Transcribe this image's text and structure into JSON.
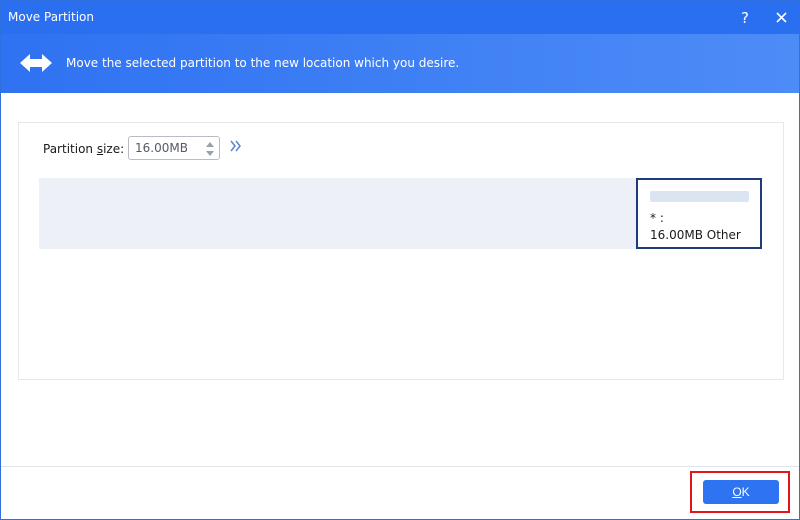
{
  "window": {
    "title": "Move Partition",
    "help_label": "?"
  },
  "banner": {
    "icon": "move-arrows-icon",
    "message": "Move the selected partition to the new location which you desire."
  },
  "partition_size": {
    "label_prefix": "Partition ",
    "label_underlined": "s",
    "label_suffix": "ize:",
    "value": "16.00MB"
  },
  "partition_block": {
    "name": "* :",
    "size": "16.00MB",
    "type": "Other"
  },
  "footer": {
    "ok_label_underlined": "O",
    "ok_label_rest": "K"
  },
  "colors": {
    "titlebar": "#2a6ff0",
    "accent": "#2e74f2",
    "highlight": "#e3151a",
    "partition_border": "#1f3c7a"
  }
}
